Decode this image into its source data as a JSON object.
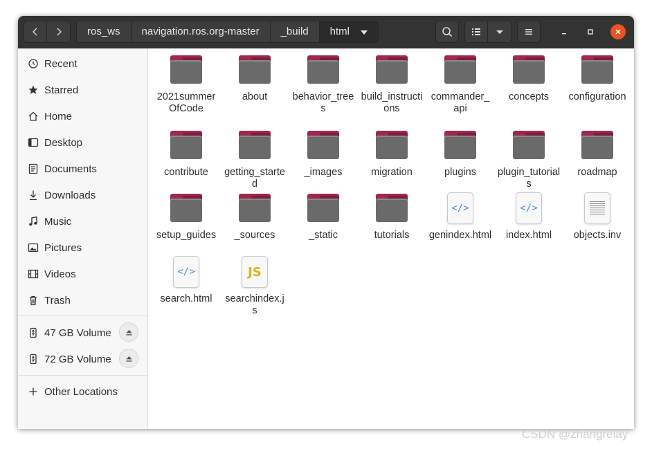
{
  "breadcrumbs": [
    "ros_ws",
    "navigation.ros.org-master",
    "_build",
    "html"
  ],
  "sidebar": {
    "places": [
      {
        "label": "Recent",
        "icon": "clock-icon"
      },
      {
        "label": "Starred",
        "icon": "star-icon"
      },
      {
        "label": "Home",
        "icon": "home-icon"
      },
      {
        "label": "Desktop",
        "icon": "desktop-icon"
      },
      {
        "label": "Documents",
        "icon": "documents-icon"
      },
      {
        "label": "Downloads",
        "icon": "downloads-icon"
      },
      {
        "label": "Music",
        "icon": "music-icon"
      },
      {
        "label": "Pictures",
        "icon": "pictures-icon"
      },
      {
        "label": "Videos",
        "icon": "videos-icon"
      },
      {
        "label": "Trash",
        "icon": "trash-icon"
      }
    ],
    "volumes": [
      {
        "label": "47 GB Volume",
        "icon": "usb-drive-icon"
      },
      {
        "label": "72 GB Volume",
        "icon": "usb-drive-icon"
      }
    ],
    "other_locations": "Other Locations"
  },
  "files": [
    {
      "name": "2021summerOfCode",
      "type": "folder"
    },
    {
      "name": "about",
      "type": "folder"
    },
    {
      "name": "behavior_trees",
      "type": "folder"
    },
    {
      "name": "build_instructions",
      "type": "folder"
    },
    {
      "name": "commander_api",
      "type": "folder"
    },
    {
      "name": "concepts",
      "type": "folder"
    },
    {
      "name": "configuration",
      "type": "folder"
    },
    {
      "name": "contribute",
      "type": "folder"
    },
    {
      "name": "getting_started",
      "type": "folder"
    },
    {
      "name": "_images",
      "type": "folder"
    },
    {
      "name": "migration",
      "type": "folder"
    },
    {
      "name": "plugins",
      "type": "folder"
    },
    {
      "name": "plugin_tutorials",
      "type": "folder"
    },
    {
      "name": "roadmap",
      "type": "folder"
    },
    {
      "name": "setup_guides",
      "type": "folder"
    },
    {
      "name": "_sources",
      "type": "folder"
    },
    {
      "name": "_static",
      "type": "folder"
    },
    {
      "name": "tutorials",
      "type": "folder"
    },
    {
      "name": "genindex.html",
      "type": "html"
    },
    {
      "name": "index.html",
      "type": "html"
    },
    {
      "name": "objects.inv",
      "type": "text"
    },
    {
      "name": "search.html",
      "type": "html"
    },
    {
      "name": "searchindex.js",
      "type": "js"
    }
  ],
  "icon_glyphs": {
    "html": "</>",
    "js": "JS"
  },
  "colors": {
    "accent": "#e95420",
    "folder_tab": "#a0284b",
    "folder_body": "#6a6a6a",
    "headerbar": "#333333"
  },
  "watermark": "CSDN @zhangrelay"
}
